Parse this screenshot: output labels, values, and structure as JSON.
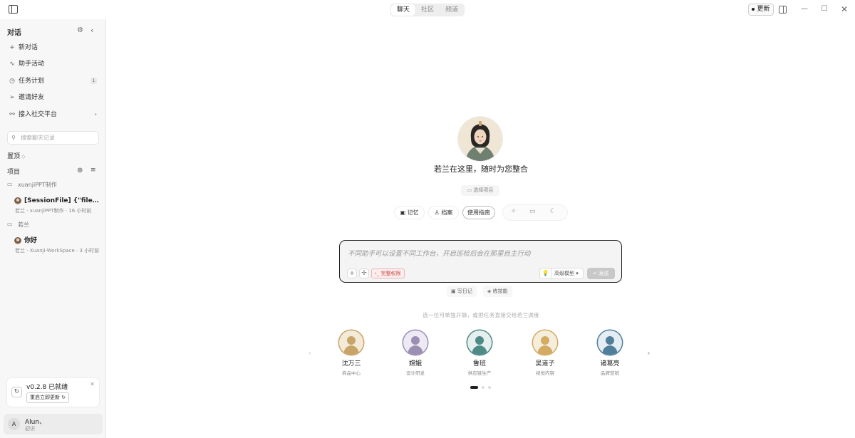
{
  "topbar": {
    "tabs": [
      "聊天",
      "社区",
      "频道"
    ],
    "active_tab": 0,
    "update_label": "更新"
  },
  "sidebar": {
    "title": "对话",
    "nav": [
      {
        "icon": "plus-icon",
        "label": "新对话"
      },
      {
        "icon": "activity-icon",
        "label": "助手活动"
      },
      {
        "icon": "clock-icon",
        "label": "任务计划",
        "badge": "1"
      },
      {
        "icon": "send-icon",
        "label": "邀请好友"
      },
      {
        "icon": "link-icon",
        "label": "接入社交平台"
      }
    ],
    "search_placeholder": "搜索聊天记录",
    "pinned_label": "置顶",
    "projects_label": "项目",
    "groups": [
      {
        "folder": "xuanjiPPT制作",
        "session_title": "[SessionFile] {\"fileId\":...",
        "session_meta": "若兰 · xuanjiPPT制作 · 16 小时前"
      },
      {
        "folder": "若兰",
        "session_title": "你好",
        "session_meta": "若兰 · Xuanji-WorkSpace · 3 小时前"
      }
    ],
    "update_card": {
      "title": "v0.2.8 已就绪",
      "button": "重启立即更新"
    },
    "user": {
      "initial": "A",
      "name": "Alun、",
      "role": "初识"
    }
  },
  "main": {
    "hero_title": "若兰在这里，随时为您整合",
    "pick_project": "选择项目",
    "chips": [
      "记忆",
      "档案",
      "使用指南"
    ],
    "composer": {
      "placeholder": "不同助手可以设置不同工作台，开启巡检后会在那里自主行动",
      "permission": "完整权限",
      "model": "高级模型",
      "send": "发送"
    },
    "sub_buttons": [
      "写日记",
      "练技能"
    ],
    "hint": "选一位可单独开聊，或把任务直接交给若兰调度",
    "agents": [
      {
        "name": "沈万三",
        "role": "商品中心",
        "color": "#c9a468",
        "bg": "#f4ead8"
      },
      {
        "name": "嫦娥",
        "role": "设计研发",
        "color": "#9b8fb3",
        "bg": "#eeeaf3"
      },
      {
        "name": "鲁班",
        "role": "供应链生产",
        "color": "#4e8a86",
        "bg": "#e5efee"
      },
      {
        "name": "吴道子",
        "role": "视觉内容",
        "color": "#d3ab62",
        "bg": "#f6eedd"
      },
      {
        "name": "诸葛亮",
        "role": "品牌营销",
        "color": "#4f7f9a",
        "bg": "#e3edf2"
      }
    ],
    "carousel_pages": 3,
    "carousel_active": 0
  }
}
